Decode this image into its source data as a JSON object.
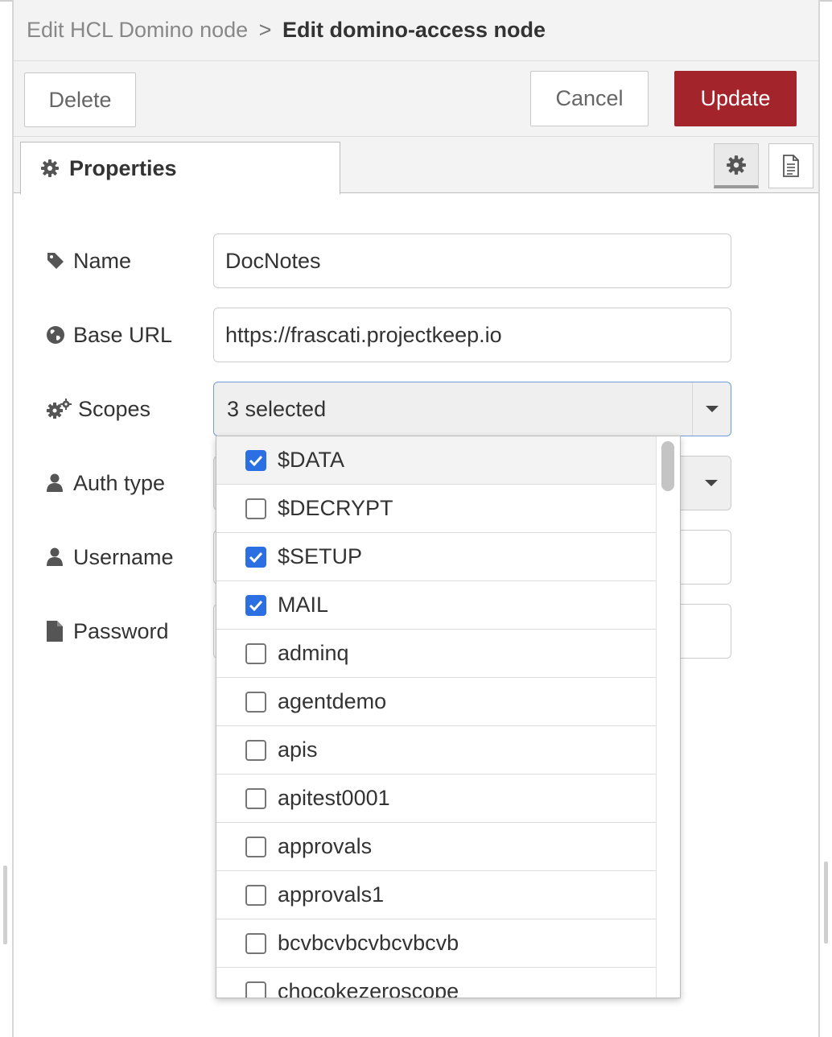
{
  "breadcrumb": {
    "parent": "Edit HCL Domino node",
    "separator": ">",
    "current": "Edit domino-access node"
  },
  "toolbar": {
    "delete_label": "Delete",
    "cancel_label": "Cancel",
    "update_label": "Update",
    "update_color": "#a4242c"
  },
  "tabs": {
    "properties_label": "Properties",
    "properties_icon": "gear-icon",
    "side_buttons": [
      "settings-gear-icon",
      "document-icon"
    ]
  },
  "form": {
    "name": {
      "label": "Name",
      "icon": "tag-icon",
      "value": "DocNotes"
    },
    "base_url": {
      "label": "Base URL",
      "icon": "globe-icon",
      "value": "https://frascati.projectkeep.io"
    },
    "scopes": {
      "label": "Scopes",
      "icon": "gears-icon",
      "value": "3 selected"
    },
    "auth_type": {
      "label": "Auth type",
      "icon": "user-icon"
    },
    "username": {
      "label": "Username",
      "icon": "user-icon"
    },
    "password": {
      "label": "Password",
      "icon": "file-icon"
    }
  },
  "scopes_dropdown": {
    "options": [
      {
        "label": "$DATA",
        "checked": true
      },
      {
        "label": "$DECRYPT",
        "checked": false
      },
      {
        "label": "$SETUP",
        "checked": true
      },
      {
        "label": "MAIL",
        "checked": true
      },
      {
        "label": "adminq",
        "checked": false
      },
      {
        "label": "agentdemo",
        "checked": false
      },
      {
        "label": "apis",
        "checked": false
      },
      {
        "label": "apitest0001",
        "checked": false
      },
      {
        "label": "approvals",
        "checked": false
      },
      {
        "label": "approvals1",
        "checked": false
      },
      {
        "label": "bcvbcvbcvbcvbcvb",
        "checked": false
      },
      {
        "label": "chocokezeroscope",
        "checked": false
      }
    ],
    "checkbox_color": "#2b6fe3"
  }
}
